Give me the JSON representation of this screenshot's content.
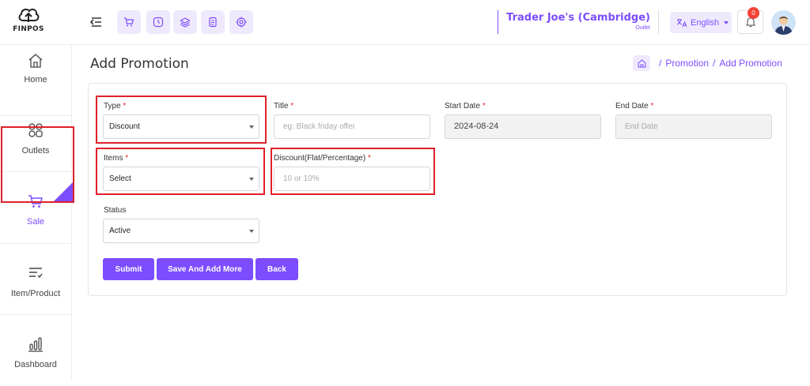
{
  "brand": {
    "logo_text": "FINPOS"
  },
  "topbar": {
    "outlet_name": "Trader Joe's (Cambridge)",
    "outlet_sub": "Outlet",
    "language": "English",
    "notification_count": "0",
    "quick_icons": [
      "cart-icon",
      "clock-icon",
      "layers-icon",
      "receipt-icon",
      "target-icon"
    ]
  },
  "sidebar": {
    "items": [
      {
        "label": "Home",
        "icon": "home-icon"
      },
      {
        "label": "Outlets",
        "icon": "outlets-icon"
      },
      {
        "label": "Sale",
        "icon": "cart-icon",
        "active": true
      },
      {
        "label": "Item/Product",
        "icon": "list-icon"
      },
      {
        "label": "Dashboard",
        "icon": "bar-chart-icon"
      }
    ]
  },
  "page": {
    "title": "Add Promotion",
    "breadcrumb": [
      "Promotion",
      "Add Promotion"
    ]
  },
  "form": {
    "type_label": "Type",
    "type_value": "Discount",
    "title_label": "Title",
    "title_placeholder": "eg: Black friday offer",
    "start_date_label": "Start Date",
    "start_date_value": "2024-08-24",
    "end_date_label": "End Date",
    "end_date_placeholder": "End Date",
    "items_label": "Items",
    "items_value": "Select",
    "discount_label": "Discount(Flat/Percentage)",
    "discount_placeholder": "10 or 10%",
    "status_label": "Status",
    "status_value": "Active",
    "required_mark": "*"
  },
  "buttons": {
    "submit": "Submit",
    "save_more": "Save And Add More",
    "back": "Back"
  },
  "colors": {
    "accent": "#7c4dff",
    "highlight": "#e0202a"
  }
}
